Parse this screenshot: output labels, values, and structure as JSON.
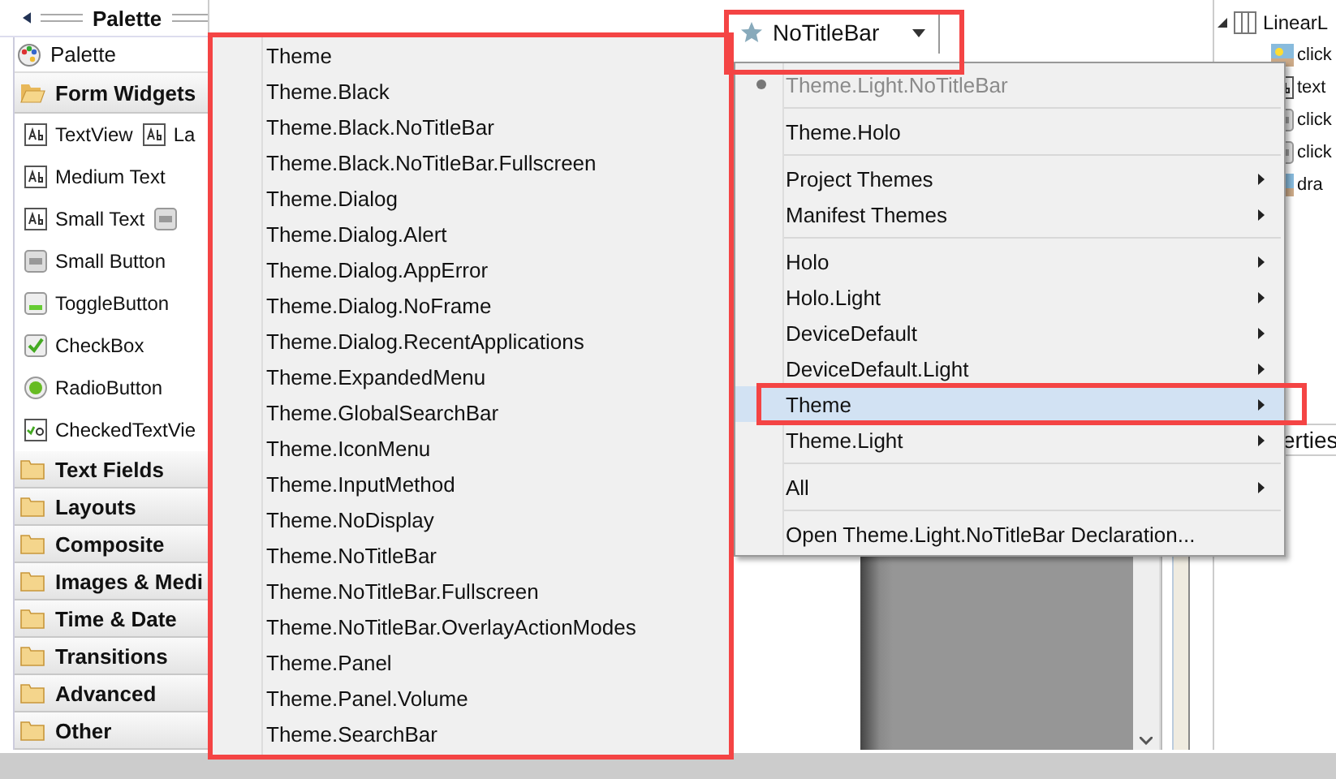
{
  "palette": {
    "title": "Palette",
    "search_label": "Palette",
    "groups": [
      {
        "label": "Form Widgets",
        "expanded": true,
        "rows": [
          {
            "widgets": [
              {
                "kind": "text",
                "label": "TextView"
              },
              {
                "kind": "text",
                "label": "La"
              }
            ]
          },
          {
            "widgets": [
              {
                "kind": "text",
                "label": "Medium Text"
              }
            ]
          },
          {
            "widgets": [
              {
                "kind": "text",
                "label": "Small Text"
              },
              {
                "kind": "button"
              }
            ]
          },
          {
            "widgets": [
              {
                "kind": "button",
                "label": "Small Button"
              }
            ]
          },
          {
            "widgets": [
              {
                "kind": "toggle",
                "label": "ToggleButton"
              }
            ]
          },
          {
            "widgets": [
              {
                "kind": "checkbox",
                "label": "CheckBox"
              }
            ]
          },
          {
            "widgets": [
              {
                "kind": "radio",
                "label": "RadioButton"
              }
            ]
          },
          {
            "widgets": [
              {
                "kind": "checkedtext",
                "label": "CheckedTextVie"
              }
            ]
          }
        ]
      },
      {
        "label": "Text Fields",
        "expanded": false
      },
      {
        "label": "Layouts",
        "expanded": false
      },
      {
        "label": "Composite",
        "expanded": false
      },
      {
        "label": "Images & Medi",
        "expanded": false
      },
      {
        "label": "Time & Date",
        "expanded": false
      },
      {
        "label": "Transitions",
        "expanded": false
      },
      {
        "label": "Advanced",
        "expanded": false
      },
      {
        "label": "Other",
        "expanded": false
      }
    ]
  },
  "toolbar": {
    "theme_button": {
      "label": "NoTitleBar",
      "highlighted": true
    }
  },
  "theme_menu": {
    "items": [
      {
        "kind": "item",
        "label": "Theme.Light.NoTitleBar",
        "checked": true,
        "disabled": true,
        "submenu": false,
        "selected": false
      },
      {
        "kind": "separator"
      },
      {
        "kind": "item",
        "label": "Theme.Holo",
        "checked": false,
        "disabled": false,
        "submenu": false,
        "selected": false
      },
      {
        "kind": "separator"
      },
      {
        "kind": "item",
        "label": "Project Themes",
        "checked": false,
        "disabled": false,
        "submenu": true,
        "selected": false
      },
      {
        "kind": "item",
        "label": "Manifest Themes",
        "checked": false,
        "disabled": false,
        "submenu": true,
        "selected": false
      },
      {
        "kind": "separator"
      },
      {
        "kind": "item",
        "label": "Holo",
        "checked": false,
        "disabled": false,
        "submenu": true,
        "selected": false
      },
      {
        "kind": "item",
        "label": "Holo.Light",
        "checked": false,
        "disabled": false,
        "submenu": true,
        "selected": false
      },
      {
        "kind": "item",
        "label": "DeviceDefault",
        "checked": false,
        "disabled": false,
        "submenu": true,
        "selected": false
      },
      {
        "kind": "item",
        "label": "DeviceDefault.Light",
        "checked": false,
        "disabled": false,
        "submenu": true,
        "selected": false
      },
      {
        "kind": "item",
        "label": "Theme",
        "checked": false,
        "disabled": false,
        "submenu": true,
        "selected": true,
        "highlighted": true
      },
      {
        "kind": "item",
        "label": "Theme.Light",
        "checked": false,
        "disabled": false,
        "submenu": true,
        "selected": false
      },
      {
        "kind": "separator"
      },
      {
        "kind": "item",
        "label": "All",
        "checked": false,
        "disabled": false,
        "submenu": true,
        "selected": false
      },
      {
        "kind": "separator"
      },
      {
        "kind": "item",
        "label": "Open Theme.Light.NoTitleBar Declaration...",
        "checked": false,
        "disabled": false,
        "submenu": false,
        "selected": false
      }
    ]
  },
  "theme_submenu": {
    "highlighted": true,
    "items": [
      "Theme",
      "Theme.Black",
      "Theme.Black.NoTitleBar",
      "Theme.Black.NoTitleBar.Fullscreen",
      "Theme.Dialog",
      "Theme.Dialog.Alert",
      "Theme.Dialog.AppError",
      "Theme.Dialog.NoFrame",
      "Theme.Dialog.RecentApplications",
      "Theme.ExpandedMenu",
      "Theme.GlobalSearchBar",
      "Theme.IconMenu",
      "Theme.InputMethod",
      "Theme.NoDisplay",
      "Theme.NoTitleBar",
      "Theme.NoTitleBar.Fullscreen",
      "Theme.NoTitleBar.OverlayActionModes",
      "Theme.Panel",
      "Theme.Panel.Volume",
      "Theme.SearchBar"
    ]
  },
  "outline": {
    "root": {
      "label": "LinearL",
      "expanded": true,
      "children": [
        {
          "kind": "image",
          "label": "click"
        },
        {
          "kind": "text",
          "label": "text"
        },
        {
          "kind": "button",
          "label": "click"
        },
        {
          "kind": "button",
          "label": "click"
        },
        {
          "kind": "image",
          "label": "dra"
        }
      ]
    }
  },
  "properties_tab": {
    "label": "erties"
  }
}
